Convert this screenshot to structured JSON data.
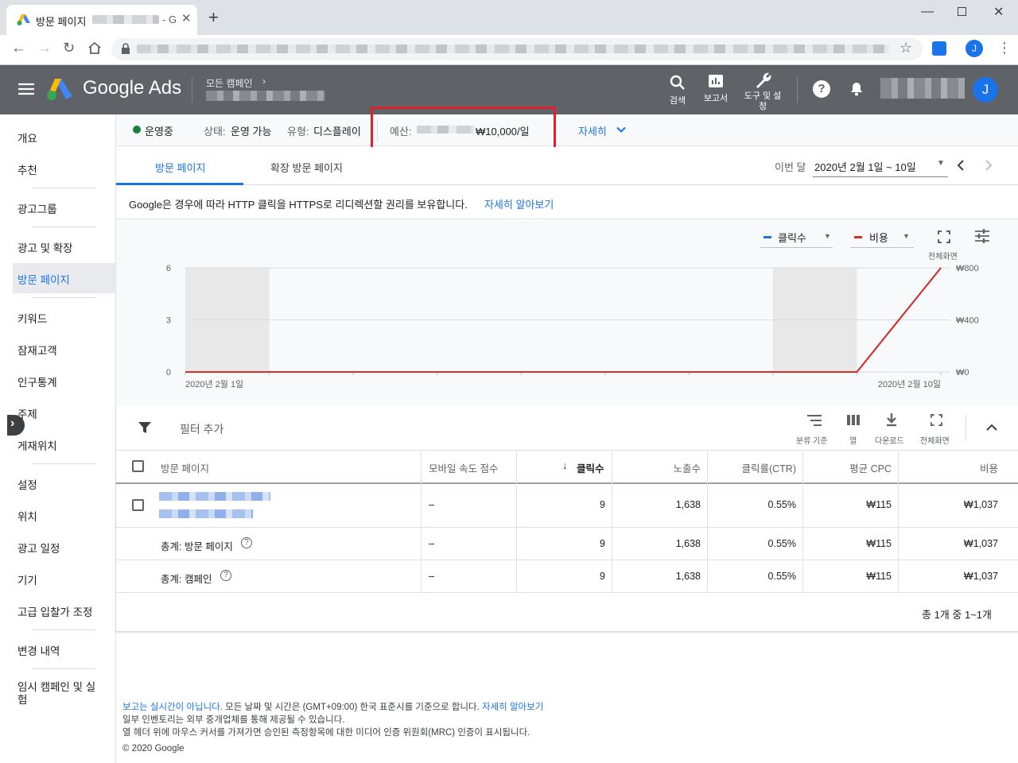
{
  "browser": {
    "tab_title": "방문 페이지",
    "tab_suffix": "- G",
    "new_tab": "+",
    "profile_initial": "J"
  },
  "header": {
    "product": "Google Ads",
    "breadcrumb": "모든 캠페인",
    "search_label": "검색",
    "reports_label": "보고서",
    "tools_label_1": "도구 및 설",
    "tools_label_2": "정",
    "avatar_initial": "J"
  },
  "sidebar": {
    "items": [
      "개요",
      "추천",
      "광고그룹",
      "광고 및 확장",
      "방문 페이지",
      "키워드",
      "잠재고객",
      "인구통계",
      "주제",
      "게재위치",
      "설정",
      "위치",
      "광고 일정",
      "기기",
      "고급 입찰가 조정",
      "변경 내역",
      "임시 캠페인 및 실험"
    ]
  },
  "status_bar": {
    "status": "운영중",
    "state_label": "상태:",
    "state_value": "운영 가능",
    "type_label": "유형:",
    "type_value": "디스플레이",
    "budget_label": "예산:",
    "budget_value": "₩10,000/일",
    "details": "자세히"
  },
  "tabs": {
    "tab1": "방문 페이지",
    "tab2": "확장 방문 페이지",
    "period_label": "이번 달",
    "period_value": "2020년 2월 1일 ~ 10일"
  },
  "notice": {
    "text": "Google은 경우에 따라 HTTP 클릭을 HTTPS로 리디렉션할 권리를 보유합니다.",
    "link": "자세히 알아보기"
  },
  "chart_controls": {
    "metric1": "클릭수",
    "metric2": "비용",
    "fullscreen": "전체화면"
  },
  "colors": {
    "clicks": "#1a73e8",
    "cost": "#d93025",
    "header": "#5f6368",
    "accent": "#1a73e8"
  },
  "chart_data": {
    "type": "line",
    "x": [
      "2020-02-01",
      "2020-02-02",
      "2020-02-03",
      "2020-02-04",
      "2020-02-05",
      "2020-02-06",
      "2020-02-07",
      "2020-02-08",
      "2020-02-09",
      "2020-02-10"
    ],
    "series": [
      {
        "name": "클릭수",
        "axis": "left",
        "values": [
          0,
          0,
          0,
          0,
          0,
          0,
          0,
          0,
          0,
          9
        ]
      },
      {
        "name": "비용",
        "axis": "right",
        "values": [
          0,
          0,
          0,
          0,
          0,
          0,
          0,
          0,
          0,
          1037
        ]
      }
    ],
    "y_left_ticks": [
      "0",
      "3",
      "6"
    ],
    "y_right_ticks": [
      "₩0",
      "₩400",
      "₩800"
    ],
    "ylim_left": [
      0,
      6
    ],
    "ylim_right": [
      0,
      800
    ],
    "x_tick_labels": [
      "2020년 2월 1일",
      "2020년 2월 10일"
    ],
    "grid": true
  },
  "table_toolbar": {
    "filter": "필터 추가",
    "segment": "분류 기준",
    "columns": "열",
    "download": "다운로드",
    "fullscreen": "전체화면"
  },
  "table": {
    "headers": [
      "방문 페이지",
      "모바일 속도 점수",
      "클릭수",
      "노출수",
      "클릭률(CTR)",
      "평균 CPC",
      "비용"
    ],
    "rows": [
      {
        "speed": "–",
        "clicks": "9",
        "impr": "1,638",
        "ctr": "0.55%",
        "cpc": "₩115",
        "cost": "₩1,037"
      }
    ],
    "totals": [
      {
        "label": "총계: 방문 페이지",
        "speed": "–",
        "clicks": "9",
        "impr": "1,638",
        "ctr": "0.55%",
        "cpc": "₩115",
        "cost": "₩1,037"
      },
      {
        "label": "총계: 캠페인",
        "speed": "–",
        "clicks": "9",
        "impr": "1,638",
        "ctr": "0.55%",
        "cpc": "₩115",
        "cost": "₩1,037"
      }
    ],
    "pagination": "총 1개 중 1~1개"
  },
  "footer": {
    "line1_link": "보고는 실시간이 아닙니다.",
    "line1_text": "모든 날짜 및 시간은 (GMT+09:00) 한국 표준시를 기준으로 합니다.",
    "line1_link2": "자세히 알아보기",
    "line2": "일부 인벤토리는 외부 중개업체를 통해 제공될 수 있습니다.",
    "line3": "열 헤더 위에 마우스 커서를 가져가면 승인된 측정항목에 대한 미디어 인증 위원회(MRC) 인증이 표시됩니다.",
    "copyright": "© 2020 Google"
  }
}
